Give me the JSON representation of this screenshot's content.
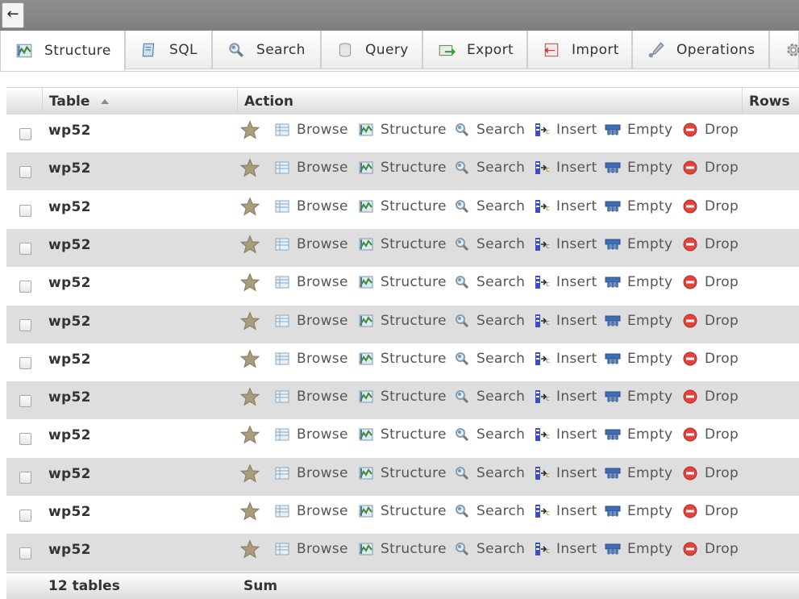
{
  "topbar": {
    "back_icon": "arrow-left-icon",
    "back_glyph": "←"
  },
  "tabs": [
    {
      "label": "Structure",
      "icon": "structure-icon",
      "active": true
    },
    {
      "label": "SQL",
      "icon": "sql-icon",
      "active": false
    },
    {
      "label": "Search",
      "icon": "search-icon",
      "active": false
    },
    {
      "label": "Query",
      "icon": "query-icon",
      "active": false
    },
    {
      "label": "Export",
      "icon": "export-icon",
      "active": false
    },
    {
      "label": "Import",
      "icon": "import-icon",
      "active": false
    },
    {
      "label": "Operations",
      "icon": "operations-icon",
      "active": false
    }
  ],
  "table": {
    "headers": {
      "table": "Table",
      "action": "Action",
      "rows": "Rows"
    },
    "actions": [
      {
        "label": "Browse",
        "icon": "browse-icon"
      },
      {
        "label": "Structure",
        "icon": "structure-icon"
      },
      {
        "label": "Search",
        "icon": "search-icon"
      },
      {
        "label": "Insert",
        "icon": "insert-icon"
      },
      {
        "label": "Empty",
        "icon": "empty-icon"
      },
      {
        "label": "Drop",
        "icon": "drop-icon"
      }
    ],
    "rows": [
      {
        "name": "wp52"
      },
      {
        "name": "wp52"
      },
      {
        "name": "wp52"
      },
      {
        "name": "wp52"
      },
      {
        "name": "wp52"
      },
      {
        "name": "wp52"
      },
      {
        "name": "wp52"
      },
      {
        "name": "wp52"
      },
      {
        "name": "wp52"
      },
      {
        "name": "wp52"
      },
      {
        "name": "wp52"
      },
      {
        "name": "wp52"
      }
    ],
    "footer": {
      "count": "12 tables",
      "sum": "Sum"
    }
  },
  "colors": {
    "row_alt": "#dedede",
    "drop_red": "#e0443c",
    "star": "#a79a78"
  }
}
